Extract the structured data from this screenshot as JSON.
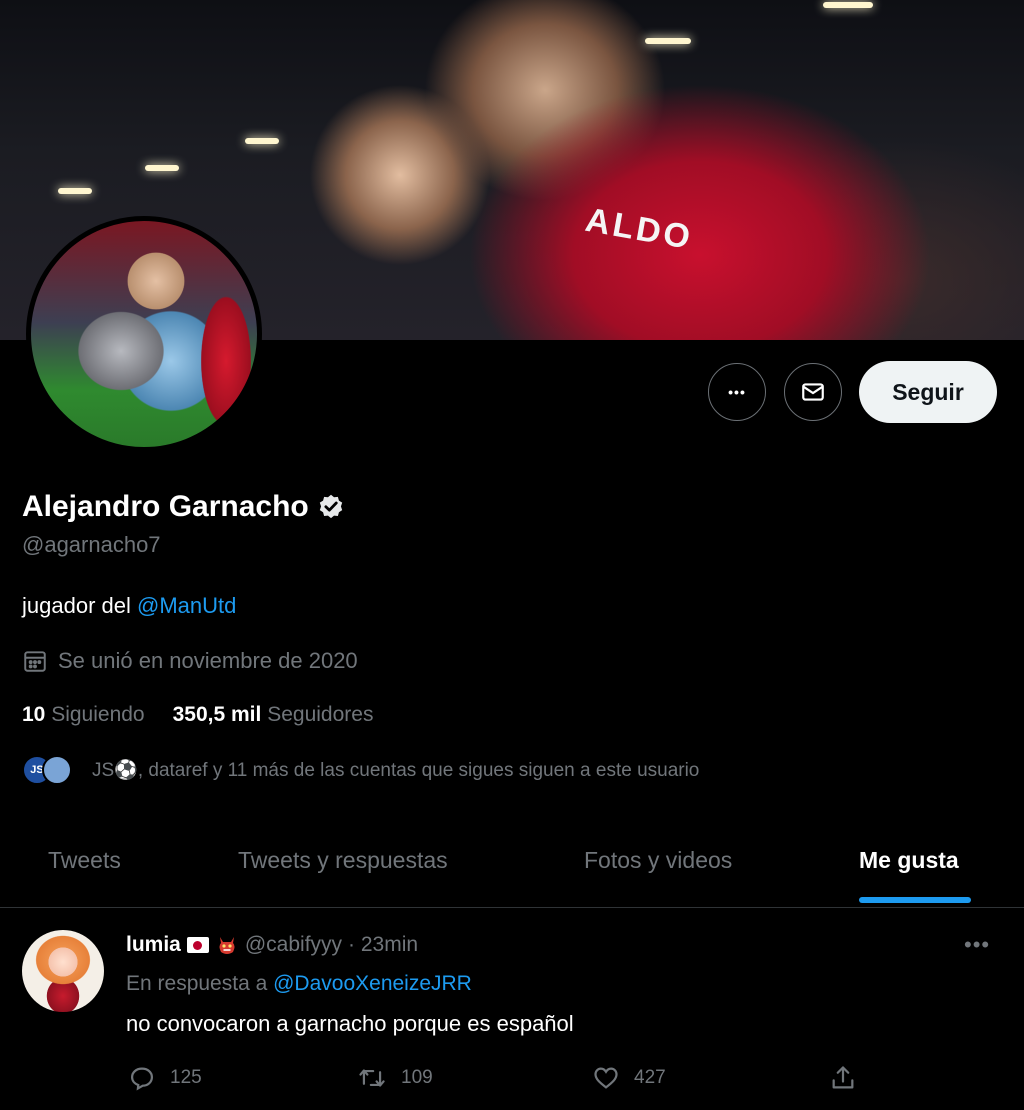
{
  "banner": {
    "jersey_text": "ALDO"
  },
  "profile": {
    "display_name": "Alejandro Garnacho",
    "handle": "@agarnacho7",
    "bio_prefix": "jugador del",
    "bio_mention": "@ManUtd",
    "joined": "Se unió en noviembre de 2020",
    "following_count": "10",
    "following_label": "Siguiendo",
    "followers_count": "350,5 mil",
    "followers_label": "Seguidores",
    "followed_by_avatar_initials": "JS",
    "followed_by_text": "JS⚽, dataref y 11 más de las cuentas que sigues siguen a este usuario"
  },
  "actions": {
    "more_label": "•••",
    "follow_label": "Seguir"
  },
  "tabs": [
    {
      "label": "Tweets"
    },
    {
      "label": "Tweets y respuestas"
    },
    {
      "label": "Fotos y videos"
    },
    {
      "label": "Me gusta"
    }
  ],
  "tweet": {
    "name": "lumia",
    "handle": "@cabifyyy",
    "time": "· 23min",
    "reply_prefix": "En respuesta a",
    "reply_to": "@DavooXeneizeJRR",
    "text": "no convocaron a garnacho porque es español",
    "more": "•••",
    "replies": "125",
    "retweets": "109",
    "likes": "427"
  },
  "colors": {
    "accent": "#1d9bf0",
    "background": "#000000",
    "secondary_text": "#71767b"
  }
}
